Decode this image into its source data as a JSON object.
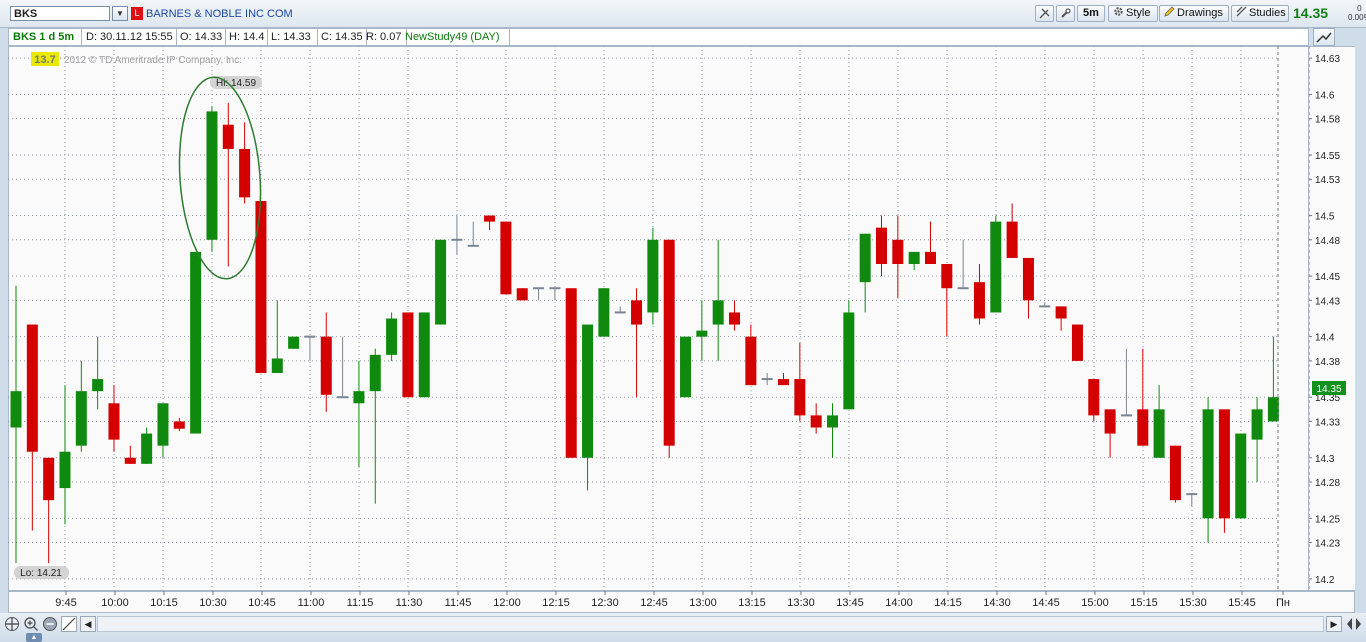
{
  "toolbar": {
    "symbol": "BKS",
    "company": "BARNES & NOBLE INC COM",
    "timeframe_label": "5m",
    "style_label": "Style",
    "drawings_label": "Drawings",
    "studies_label": "Studies",
    "last_price": "14.35",
    "change_top": "0",
    "change_pct": "0.00%"
  },
  "info": {
    "symbol_desc": "BKS 1 d 5m",
    "date": "D: 30.11.12 15:55",
    "open": "O: 14.33",
    "high": "H: 14.4",
    "low": "L: 14.33",
    "close": "C: 14.35",
    "range": "R: 0.07",
    "study": "NewStudy49 (DAY)"
  },
  "chart": {
    "badge_value": "13.7",
    "copyright": "2012 © TD Ameritrade IP Company, Inc.",
    "hi_label": "Hi: 14.59",
    "lo_label": "Lo: 14.21",
    "price_tag": "14.35",
    "colors": {
      "up": "#0f8a0f",
      "down": "#d40000",
      "flat": "#7a8593",
      "tag": "#13911d"
    }
  },
  "chart_data": {
    "type": "candlestick",
    "ylim": [
      14.19,
      14.64
    ],
    "y_ticks": [
      "14.63",
      "14.6",
      "14.58",
      "14.55",
      "14.53",
      "14.5",
      "14.48",
      "14.45",
      "14.43",
      "14.4",
      "14.38",
      "14.35",
      "14.33",
      "14.3",
      "14.28",
      "14.25",
      "14.23",
      "14.2"
    ],
    "x_ticks": [
      "9:45",
      "10:00",
      "10:15",
      "10:30",
      "10:45",
      "11:00",
      "11:15",
      "11:30",
      "11:45",
      "12:00",
      "12:15",
      "12:30",
      "12:45",
      "13:00",
      "13:15",
      "13:30",
      "13:45",
      "14:00",
      "14:15",
      "14:30",
      "14:45",
      "15:00",
      "15:15",
      "15:30",
      "15:45",
      "Пн"
    ],
    "candles": [
      {
        "o": 14.325,
        "h": 14.442,
        "l": 14.213,
        "c": 14.355
      },
      {
        "o": 14.41,
        "h": 14.41,
        "l": 14.24,
        "c": 14.305
      },
      {
        "o": 14.3,
        "h": 14.3,
        "l": 14.213,
        "c": 14.265
      },
      {
        "o": 14.275,
        "h": 14.36,
        "l": 14.245,
        "c": 14.305
      },
      {
        "o": 14.31,
        "h": 14.38,
        "l": 14.305,
        "c": 14.355
      },
      {
        "o": 14.355,
        "h": 14.4,
        "l": 14.34,
        "c": 14.365
      },
      {
        "o": 14.345,
        "h": 14.36,
        "l": 14.305,
        "c": 14.315
      },
      {
        "o": 14.3,
        "h": 14.31,
        "l": 14.295,
        "c": 14.295
      },
      {
        "o": 14.295,
        "h": 14.325,
        "l": 14.295,
        "c": 14.32
      },
      {
        "o": 14.31,
        "h": 14.345,
        "l": 14.3,
        "c": 14.345
      },
      {
        "o": 14.33,
        "h": 14.333,
        "l": 14.322,
        "c": 14.324
      },
      {
        "o": 14.32,
        "h": 14.47,
        "l": 14.32,
        "c": 14.47
      },
      {
        "o": 14.48,
        "h": 14.59,
        "l": 14.47,
        "c": 14.586
      },
      {
        "o": 14.575,
        "h": 14.593,
        "l": 14.458,
        "c": 14.555
      },
      {
        "o": 14.555,
        "h": 14.577,
        "l": 14.51,
        "c": 14.515
      },
      {
        "o": 14.512,
        "h": 14.512,
        "l": 14.37,
        "c": 14.37
      },
      {
        "o": 14.37,
        "h": 14.43,
        "l": 14.37,
        "c": 14.382
      },
      {
        "o": 14.39,
        "h": 14.4,
        "l": 14.39,
        "c": 14.4
      },
      {
        "o": 14.4,
        "h": 14.4,
        "l": 14.38,
        "c": 14.4
      },
      {
        "o": 14.4,
        "h": 14.42,
        "l": 14.338,
        "c": 14.352
      },
      {
        "o": 14.35,
        "h": 14.4,
        "l": 14.35,
        "c": 14.35
      },
      {
        "o": 14.345,
        "h": 14.38,
        "l": 14.292,
        "c": 14.355
      },
      {
        "o": 14.355,
        "h": 14.39,
        "l": 14.262,
        "c": 14.385
      },
      {
        "o": 14.385,
        "h": 14.42,
        "l": 14.38,
        "c": 14.415
      },
      {
        "o": 14.42,
        "h": 14.42,
        "l": 14.35,
        "c": 14.35
      },
      {
        "o": 14.35,
        "h": 14.42,
        "l": 14.35,
        "c": 14.42
      },
      {
        "o": 14.41,
        "h": 14.48,
        "l": 14.41,
        "c": 14.48
      },
      {
        "o": 14.48,
        "h": 14.5,
        "l": 14.468,
        "c": 14.48
      },
      {
        "o": 14.475,
        "h": 14.495,
        "l": 14.475,
        "c": 14.475
      },
      {
        "o": 14.5,
        "h": 14.5,
        "l": 14.488,
        "c": 14.495
      },
      {
        "o": 14.495,
        "h": 14.495,
        "l": 14.435,
        "c": 14.435
      },
      {
        "o": 14.44,
        "h": 14.44,
        "l": 14.43,
        "c": 14.43
      },
      {
        "o": 14.44,
        "h": 14.44,
        "l": 14.43,
        "c": 14.44
      },
      {
        "o": 14.44,
        "h": 14.44,
        "l": 14.43,
        "c": 14.44
      },
      {
        "o": 14.44,
        "h": 14.44,
        "l": 14.3,
        "c": 14.3
      },
      {
        "o": 14.3,
        "h": 14.41,
        "l": 14.273,
        "c": 14.41
      },
      {
        "o": 14.4,
        "h": 14.44,
        "l": 14.4,
        "c": 14.44
      },
      {
        "o": 14.42,
        "h": 14.425,
        "l": 14.42,
        "c": 14.42
      },
      {
        "o": 14.43,
        "h": 14.44,
        "l": 14.35,
        "c": 14.41
      },
      {
        "o": 14.42,
        "h": 14.49,
        "l": 14.41,
        "c": 14.48
      },
      {
        "o": 14.48,
        "h": 14.48,
        "l": 14.3,
        "c": 14.31
      },
      {
        "o": 14.35,
        "h": 14.4,
        "l": 14.35,
        "c": 14.4
      },
      {
        "o": 14.4,
        "h": 14.43,
        "l": 14.38,
        "c": 14.405
      },
      {
        "o": 14.41,
        "h": 14.48,
        "l": 14.38,
        "c": 14.43
      },
      {
        "o": 14.42,
        "h": 14.43,
        "l": 14.405,
        "c": 14.41
      },
      {
        "o": 14.4,
        "h": 14.41,
        "l": 14.36,
        "c": 14.36
      },
      {
        "o": 14.365,
        "h": 14.37,
        "l": 14.36,
        "c": 14.365
      },
      {
        "o": 14.365,
        "h": 14.37,
        "l": 14.36,
        "c": 14.36
      },
      {
        "o": 14.365,
        "h": 14.395,
        "l": 14.33,
        "c": 14.335
      },
      {
        "o": 14.335,
        "h": 14.345,
        "l": 14.32,
        "c": 14.325
      },
      {
        "o": 14.325,
        "h": 14.345,
        "l": 14.3,
        "c": 14.335
      },
      {
        "o": 14.34,
        "h": 14.43,
        "l": 14.34,
        "c": 14.42
      },
      {
        "o": 14.445,
        "h": 14.485,
        "l": 14.42,
        "c": 14.485
      },
      {
        "o": 14.49,
        "h": 14.5,
        "l": 14.45,
        "c": 14.46
      },
      {
        "o": 14.48,
        "h": 14.5,
        "l": 14.432,
        "c": 14.46
      },
      {
        "o": 14.46,
        "h": 14.47,
        "l": 14.455,
        "c": 14.47
      },
      {
        "o": 14.47,
        "h": 14.495,
        "l": 14.46,
        "c": 14.46
      },
      {
        "o": 14.46,
        "h": 14.46,
        "l": 14.4,
        "c": 14.44
      },
      {
        "o": 14.44,
        "h": 14.48,
        "l": 14.44,
        "c": 14.44
      },
      {
        "o": 14.445,
        "h": 14.46,
        "l": 14.41,
        "c": 14.415
      },
      {
        "o": 14.42,
        "h": 14.5,
        "l": 14.42,
        "c": 14.495
      },
      {
        "o": 14.495,
        "h": 14.51,
        "l": 14.465,
        "c": 14.465
      },
      {
        "o": 14.465,
        "h": 14.465,
        "l": 14.415,
        "c": 14.43
      },
      {
        "o": 14.425,
        "h": 14.428,
        "l": 14.425,
        "c": 14.425
      },
      {
        "o": 14.425,
        "h": 14.425,
        "l": 14.405,
        "c": 14.415
      },
      {
        "o": 14.41,
        "h": 14.41,
        "l": 14.38,
        "c": 14.38
      },
      {
        "o": 14.365,
        "h": 14.365,
        "l": 14.33,
        "c": 14.335
      },
      {
        "o": 14.34,
        "h": 14.34,
        "l": 14.3,
        "c": 14.32
      },
      {
        "o": 14.335,
        "h": 14.39,
        "l": 14.335,
        "c": 14.335
      },
      {
        "o": 14.34,
        "h": 14.39,
        "l": 14.31,
        "c": 14.31
      },
      {
        "o": 14.3,
        "h": 14.36,
        "l": 14.3,
        "c": 14.34
      },
      {
        "o": 14.31,
        "h": 14.31,
        "l": 14.263,
        "c": 14.265
      },
      {
        "o": 14.27,
        "h": 14.27,
        "l": 14.26,
        "c": 14.27
      },
      {
        "o": 14.25,
        "h": 14.35,
        "l": 14.23,
        "c": 14.34
      },
      {
        "o": 14.34,
        "h": 14.34,
        "l": 14.238,
        "c": 14.25
      },
      {
        "o": 14.25,
        "h": 14.32,
        "l": 14.25,
        "c": 14.32
      },
      {
        "o": 14.315,
        "h": 14.35,
        "l": 14.28,
        "c": 14.34
      },
      {
        "o": 14.33,
        "h": 14.4,
        "l": 14.33,
        "c": 14.35
      }
    ]
  }
}
